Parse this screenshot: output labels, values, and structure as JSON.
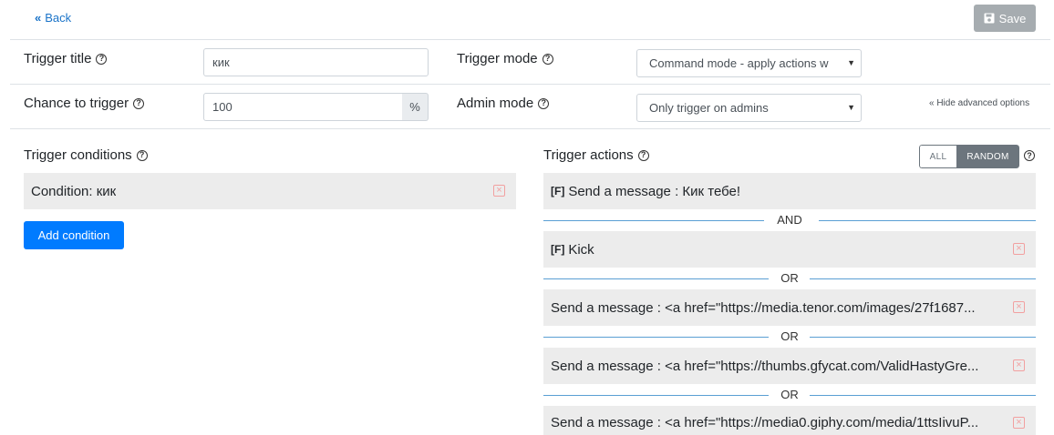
{
  "header": {
    "back_label": "Back",
    "save_label": "Save"
  },
  "form": {
    "trigger_title_label": "Trigger title",
    "trigger_title_value": "кик",
    "chance_label": "Chance to trigger",
    "chance_value": "100",
    "chance_unit": "%",
    "trigger_mode_label": "Trigger mode",
    "trigger_mode_value": "Command mode - apply actions w",
    "admin_mode_label": "Admin mode",
    "admin_mode_value": "Only trigger on admins",
    "hide_advanced": "« Hide advanced options"
  },
  "conditions": {
    "heading": "Trigger conditions",
    "items": [
      {
        "text": "Condition: кик"
      }
    ],
    "add_button": "Add condition"
  },
  "actions": {
    "heading": "Trigger actions",
    "mode_all": "ALL",
    "mode_random": "RANDOM",
    "selected_mode": "RANDOM",
    "items": [
      {
        "flag": "[F]",
        "text": "Send a message : Кик тебе!"
      },
      {
        "flag": "[F]",
        "text": "Kick"
      },
      {
        "flag": "",
        "text": "Send a message : <a href=\"https://media.tenor.com/images/27f1687..."
      },
      {
        "flag": "",
        "text": "Send a message : <a href=\"https://thumbs.gfycat.com/ValidHastyGre..."
      },
      {
        "flag": "",
        "text": "Send a message : <a href=\"https://media0.giphy.com/media/1ttsIivuP..."
      }
    ],
    "separators": [
      "AND",
      "OR",
      "OR",
      "OR"
    ]
  },
  "colors": {
    "primary": "#007bff",
    "link": "#1a73c8",
    "save_disabled": "#a6acb0",
    "card_bg": "#ececec",
    "separator_line": "#5a9fd4",
    "remove_icon": "#f2a0a0"
  }
}
